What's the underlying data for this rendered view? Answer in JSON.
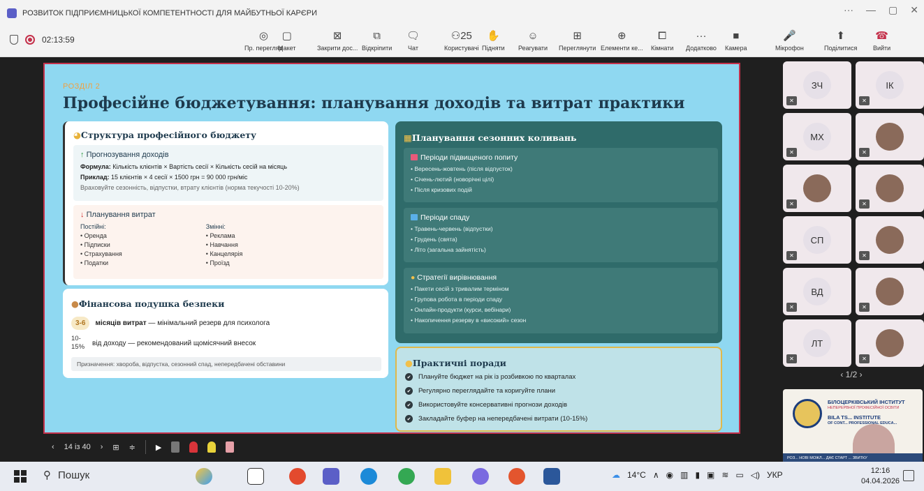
{
  "window": {
    "title": "РОЗВИТОК ПІДПРИЄМНИЦЬКОЇ КОМПЕТЕНТНОСТІ ДЛЯ МАЙБУТНЬОЇ КАРЄРИ",
    "controls": [
      "···",
      "—",
      "▢",
      "✕"
    ]
  },
  "meeting": {
    "timer": "02:13:59",
    "toolbar": [
      {
        "label": "Пр. перегляд",
        "icon": "eye-icon",
        "glyph": "◎"
      },
      {
        "label": "Макет",
        "icon": "layout-icon",
        "glyph": "▢"
      },
      {
        "label": "Закрити дос...",
        "icon": "close-share-icon",
        "glyph": "⊠"
      },
      {
        "label": "Відкріпити",
        "icon": "unpin-icon",
        "glyph": "⧉"
      },
      {
        "label": "Чат",
        "icon": "chat-icon",
        "glyph": "🗨"
      },
      {
        "label": "Користувачі",
        "icon": "people-icon",
        "glyph": "⚇25"
      },
      {
        "label": "Підняти",
        "icon": "raise-hand-icon",
        "glyph": "✋"
      },
      {
        "label": "Реагувати",
        "icon": "react-icon",
        "glyph": "☺"
      },
      {
        "label": "Переглянути",
        "icon": "view-icon",
        "glyph": "⊞"
      },
      {
        "label": "Елементи ке...",
        "icon": "apps-icon",
        "glyph": "⊕"
      },
      {
        "label": "Кімнати",
        "icon": "rooms-icon",
        "glyph": "⧠"
      },
      {
        "label": "Додатково",
        "icon": "more-icon",
        "glyph": "···"
      },
      {
        "label": "Камера",
        "icon": "camera-icon",
        "glyph": "■"
      },
      {
        "label": "Мікрофон",
        "icon": "mic-icon",
        "glyph": "🎤"
      },
      {
        "label": "Поділитися",
        "icon": "share-icon",
        "glyph": "⬆"
      },
      {
        "label": "Вийти",
        "icon": "leave-icon",
        "glyph": "☎"
      }
    ]
  },
  "slide": {
    "section": "РОЗДІЛ 2",
    "title": "Професійне бюджетування: планування доходів та витрат практики",
    "budget": {
      "heading": "Структура професійного бюджету",
      "income_heading": "Прогнозування доходів",
      "formula_label": "Формула:",
      "formula": " Кількість клієнтів × Вартість сесії × Кількість сесій на місяць",
      "example_label": "Приклад:",
      "example": " 15 клієнтів × 4 сесії × 1500 грн = 90 000 грн/міс",
      "note": "Враховуйте сезонність, відпустки, втрату клієнтів (норма текучості 10-20%)",
      "expense_heading": "Планування витрат",
      "fixed_label": "Постійні:",
      "fixed": [
        "Оренда",
        "Підписки",
        "Страхування",
        "Податки"
      ],
      "variable_label": "Змінні:",
      "variable": [
        "Реклама",
        "Навчання",
        "Канцелярія",
        "Проїзд"
      ]
    },
    "safety": {
      "heading": "Фінансова подушка безпеки",
      "row1_num": "3-6",
      "row1_bold": "місяців витрат",
      "row1_rest": " — мінімальний резерв для психолога",
      "row2_num": "10-15%",
      "row2_text": "від доходу — рекомендований щомісячний внесок",
      "purpose": "Призначення: хвороба, відпустка, сезонний спад, непередбачені обставини"
    },
    "seasonal": {
      "heading": "Планування сезонних коливань",
      "peak_heading": "Періоди підвищеного попиту",
      "peak": [
        "Вересень-жовтень (після відпусток)",
        "Січень-лютий (новорічні цілі)",
        "Після кризових подій"
      ],
      "low_heading": "Періоди спаду",
      "low": [
        "Травень-червень (відпустки)",
        "Грудень (свята)",
        "Літо (загальна зайнятість)"
      ],
      "strategy_heading": "Стратегії вирівнювання",
      "strategy": [
        "Пакети сесій з тривалим терміном",
        "Групова робота в періоди спаду",
        "Онлайн-продукти (курси, вебінари)",
        "Накопичення резерву в «високий» сезон"
      ]
    },
    "tips": {
      "heading": "Практичні поради",
      "items": [
        "Плануйте бюджет на рік із розбивкою по кварталах",
        "Регулярно переглядайте та коригуйте плани",
        "Використовуйте консервативні прогнози доходів",
        "Закладайте буфер на непередбачені витрати (10-15%)"
      ]
    }
  },
  "slide_nav": {
    "counter": "14 із 40"
  },
  "participants": {
    "tiles": [
      {
        "initials": "ЗЧ",
        "photo": false
      },
      {
        "initials": "ІК",
        "photo": false
      },
      {
        "initials": "МХ",
        "photo": false
      },
      {
        "initials": "",
        "photo": true
      },
      {
        "initials": "",
        "photo": true
      },
      {
        "initials": "",
        "photo": true
      },
      {
        "initials": "СП",
        "photo": false
      },
      {
        "initials": "",
        "photo": true
      },
      {
        "initials": "ВД",
        "photo": false
      },
      {
        "initials": "",
        "photo": true
      },
      {
        "initials": "ЛТ",
        "photo": false
      },
      {
        "initials": "",
        "photo": true
      }
    ],
    "pager": "1/2",
    "video": {
      "line1": "БІЛОЦЕРКІВСЬКИЙ ІНСТИТУТ",
      "line2": "НЕПЕРЕРВНОЇ ПРОФЕСІЙНОЇ ОСВІТИ",
      "line3": "BILA TS... INSTITUTE",
      "line4": "OF CONT... PROFESSIONAL EDUCA...",
      "footer": "РОЗ... НОВІ МОЖЛ... ДАЄ СТАРТ ... ЗВИТКУ"
    }
  },
  "taskbar": {
    "search": "Пошук",
    "weather": "14°C",
    "lang": "УКР",
    "time": "12:16",
    "date": "04.04.2026"
  }
}
